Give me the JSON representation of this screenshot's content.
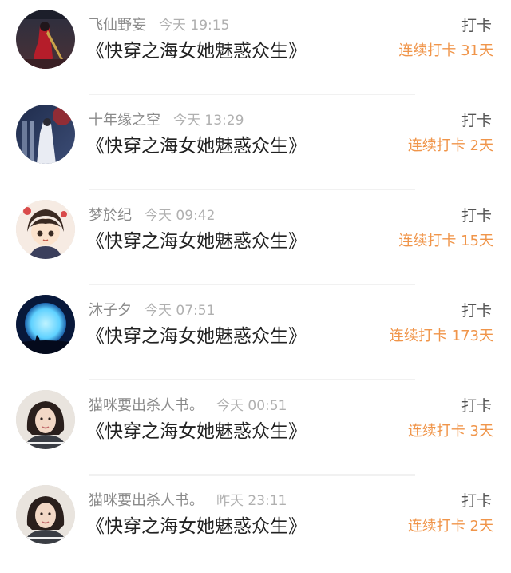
{
  "checkins": [
    {
      "name": "飞仙野妄",
      "time": "今天 19:15",
      "title": "《快穿之海女她魅惑众生》",
      "action": "打卡",
      "streak": "连续打卡 31天",
      "avatar_icon": "avatar-red-robed-figure"
    },
    {
      "name": "十年缘之空",
      "time": "今天 13:29",
      "title": "《快穿之海女她魅惑众生》",
      "action": "打卡",
      "streak": "连续打卡 2天",
      "avatar_icon": "avatar-white-robed-figure"
    },
    {
      "name": "梦於纪",
      "time": "今天 09:42",
      "title": "《快穿之海女她魅惑众生》",
      "action": "打卡",
      "streak": "连续打卡 15天",
      "avatar_icon": "avatar-cartoon-character"
    },
    {
      "name": "沐子夕",
      "time": "今天 07:51",
      "title": "《快穿之海女她魅惑众生》",
      "action": "打卡",
      "streak": "连续打卡 173天",
      "avatar_icon": "avatar-blue-moon"
    },
    {
      "name": "猫咪要出杀人书。",
      "time": "今天 00:51",
      "title": "《快穿之海女她魅惑众生》",
      "action": "打卡",
      "streak": "连续打卡 3天",
      "avatar_icon": "avatar-girl-photo"
    },
    {
      "name": "猫咪要出杀人书。",
      "time": "昨天 23:11",
      "title": "《快穿之海女她魅惑众生》",
      "action": "打卡",
      "streak": "连续打卡 2天",
      "avatar_icon": "avatar-girl-photo"
    }
  ],
  "colors": {
    "streak": "#f0954a",
    "name": "#8a8a8a",
    "time": "#b0b0b0",
    "title": "#222222",
    "action": "#555555",
    "divider": "#f1f1f1"
  }
}
